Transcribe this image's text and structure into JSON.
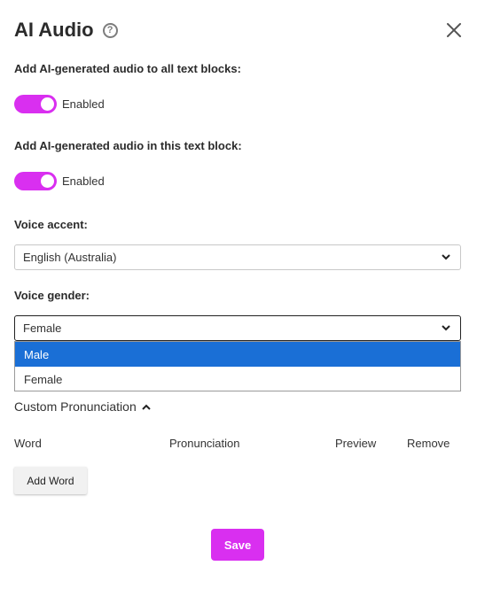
{
  "dialog": {
    "title": "AI Audio",
    "help_icon": "question-circle-icon",
    "close_icon": "close-icon"
  },
  "all_blocks": {
    "label": "Add AI-generated audio to all text blocks:",
    "toggle_state": "Enabled",
    "enabled": true
  },
  "this_block": {
    "label": "Add AI-generated audio in this text block:",
    "toggle_state": "Enabled",
    "enabled": true
  },
  "voice_accent": {
    "label": "Voice accent:",
    "value": "English (Australia)"
  },
  "voice_gender": {
    "label": "Voice gender:",
    "value": "Female",
    "options": [
      "Male",
      "Female"
    ],
    "highlighted_option": "Male"
  },
  "pronunciation": {
    "header": "Custom Pronunciation",
    "columns": [
      "Word",
      "Pronunciation",
      "Preview",
      "Remove"
    ],
    "add_word_label": "Add Word"
  },
  "footer": {
    "save_label": "Save"
  },
  "colors": {
    "accent": "#d92ff0",
    "selected_option": "#1a6fd6"
  }
}
